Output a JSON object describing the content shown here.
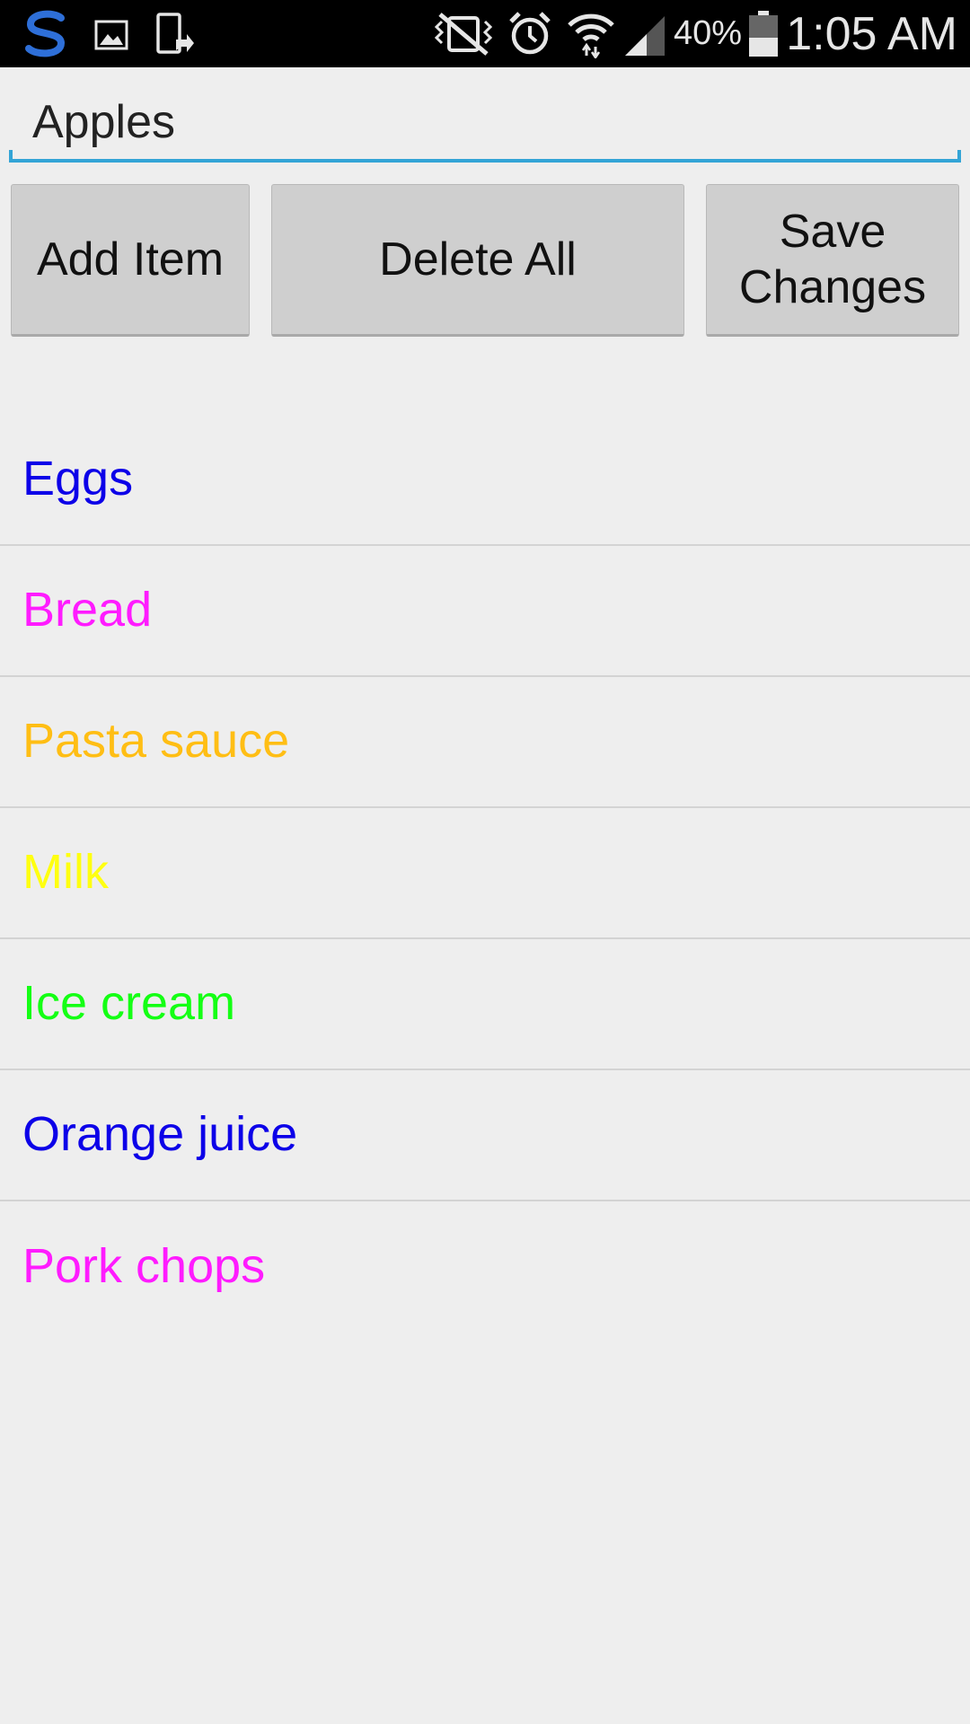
{
  "status_bar": {
    "battery_percent": "40%",
    "time": "1:05 AM",
    "icons": [
      "app-s-icon",
      "image-icon",
      "phone-transfer-icon",
      "vibrate-mute-icon",
      "alarm-icon",
      "wifi-icon",
      "signal-icon",
      "battery-icon"
    ]
  },
  "input": {
    "value": "Apples"
  },
  "buttons": {
    "add": "Add Item",
    "delete": "Delete All",
    "save": "Save\nChanges"
  },
  "list": {
    "items": [
      {
        "label": "Eggs",
        "color": "#0c00e8"
      },
      {
        "label": "Bread",
        "color": "#ff1bff"
      },
      {
        "label": "Pasta sauce",
        "color": "#ffbe14"
      },
      {
        "label": "Milk",
        "color": "#ffff10"
      },
      {
        "label": "Ice cream",
        "color": "#14ff14"
      },
      {
        "label": "Orange juice",
        "color": "#0c00e8"
      },
      {
        "label": "Pork chops",
        "color": "#ff1bff"
      }
    ]
  }
}
